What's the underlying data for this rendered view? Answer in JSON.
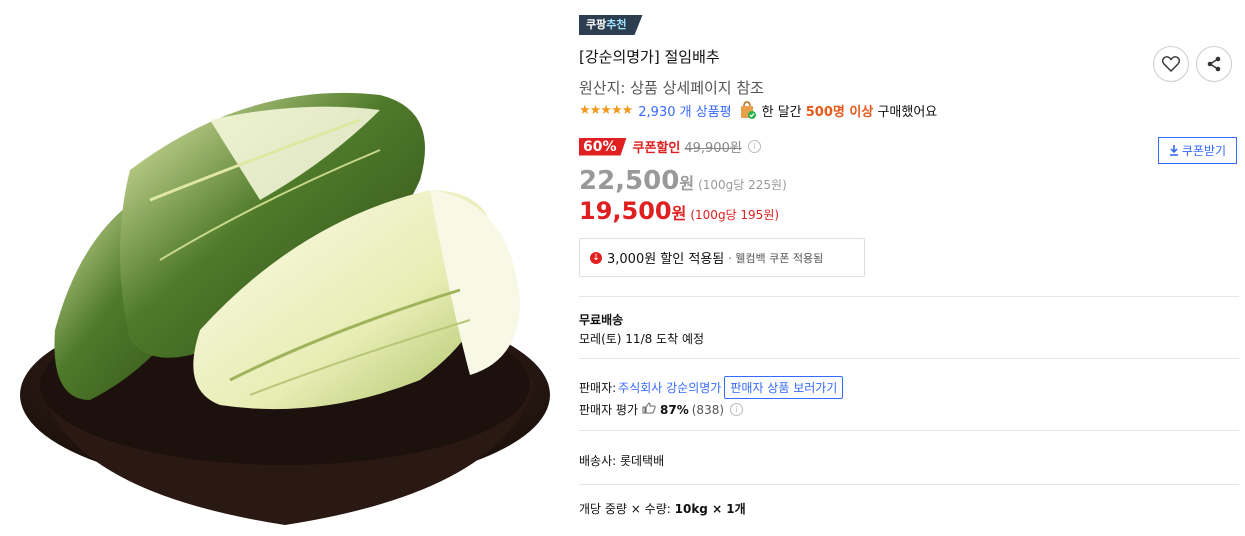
{
  "badge": {
    "prefix": "쿠팡",
    "accent": "추천"
  },
  "product": {
    "title": "[강순의명가] 절임배추",
    "origin": "원산지: 상품 상세페이지 참조",
    "stars": "★★★★★",
    "rating_score": 4.5,
    "rating_count": "2,930 개 상품평",
    "purchase_prefix": "한 달간",
    "purchase_highlight": "500명 이상",
    "purchase_suffix": "구매했어요"
  },
  "pricing": {
    "discount_pct": "60%",
    "coupon_label": "쿠폰할인",
    "original_price": "49,900원",
    "coupon_button": "쿠폰받기",
    "sale_price": "22,500",
    "sale_won": "원",
    "sale_unit": "(100g당 225원)",
    "coupon_price": "19,500",
    "coupon_won": "원",
    "coupon_unit": "(100g당 195원)",
    "applied_text": "3,000원 할인 적용됨",
    "applied_sub": "· 웰컴백 쿠폰 적용됨"
  },
  "shipping": {
    "label": "무료배송",
    "date": "모레(토) 11/8 도착 예정"
  },
  "seller": {
    "label": "판매자:",
    "name": "주식회사 강순의명가",
    "button": "판매자 상품 보러가기",
    "rating_label": "판매자 평가",
    "rating_pct": "87%",
    "rating_count": "(838)"
  },
  "carrier": "배송사:  롯데택배",
  "weight": {
    "label": "개당 중량 × 수량:",
    "value": "10kg × 1개"
  },
  "colors": {
    "accent": "#346aff",
    "sale": "#e02020",
    "badge": "#2c3e50"
  }
}
